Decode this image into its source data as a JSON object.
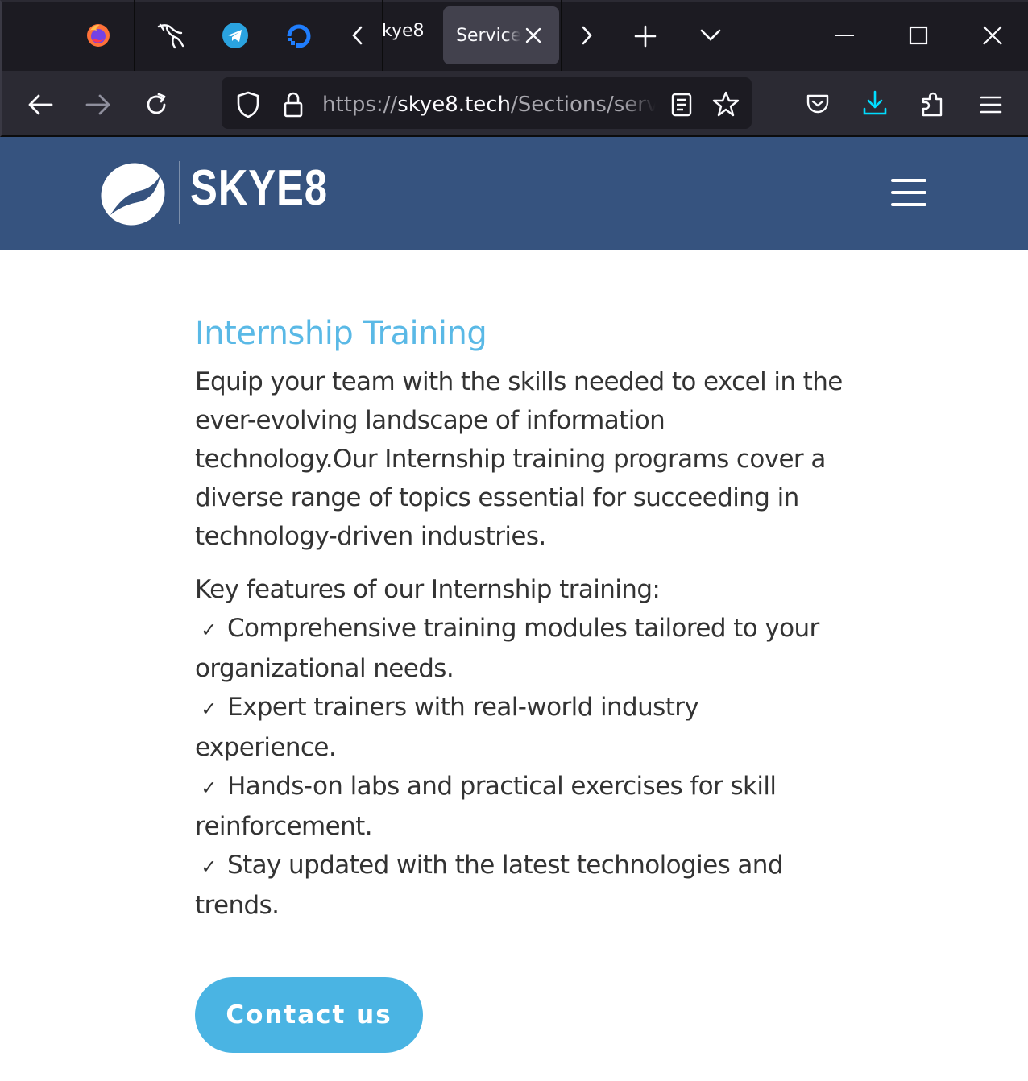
{
  "browser": {
    "tabs": [
      {
        "label": "kye8"
      },
      {
        "label": "Services",
        "active": true
      }
    ],
    "url": {
      "prefix": "https://",
      "host": "skye8.tech",
      "path": "/Sections/service"
    },
    "icons": {
      "firefox": "firefox-icon",
      "kali": "kali-dragon-icon",
      "telegram": "telegram-icon",
      "digitalocean": "digitalocean-icon"
    },
    "colors": {
      "titlebar": "#1c1b22",
      "toolbar": "#2b2a33",
      "download_accent": "#00ddff"
    }
  },
  "site": {
    "brand": "SKYE8",
    "header_color": "#36537f"
  },
  "content": {
    "heading": "Internship Training",
    "intro": "Equip your team with the skills needed to excel in the ever-evolving landscape of information technology.Our Internship training programs cover a diverse range of topics essential for succeeding in technology-driven industries.",
    "features_title": "Key features of our Internship training:",
    "features": [
      "Comprehensive training modules tailored to your organizational needs.",
      "Expert trainers with real-world industry experience.",
      "Hands-on labs and practical exercises for skill reinforcement.",
      "Stay updated with the latest technologies and trends."
    ],
    "cta": "Contact us",
    "accent": "#4ab4e3"
  }
}
